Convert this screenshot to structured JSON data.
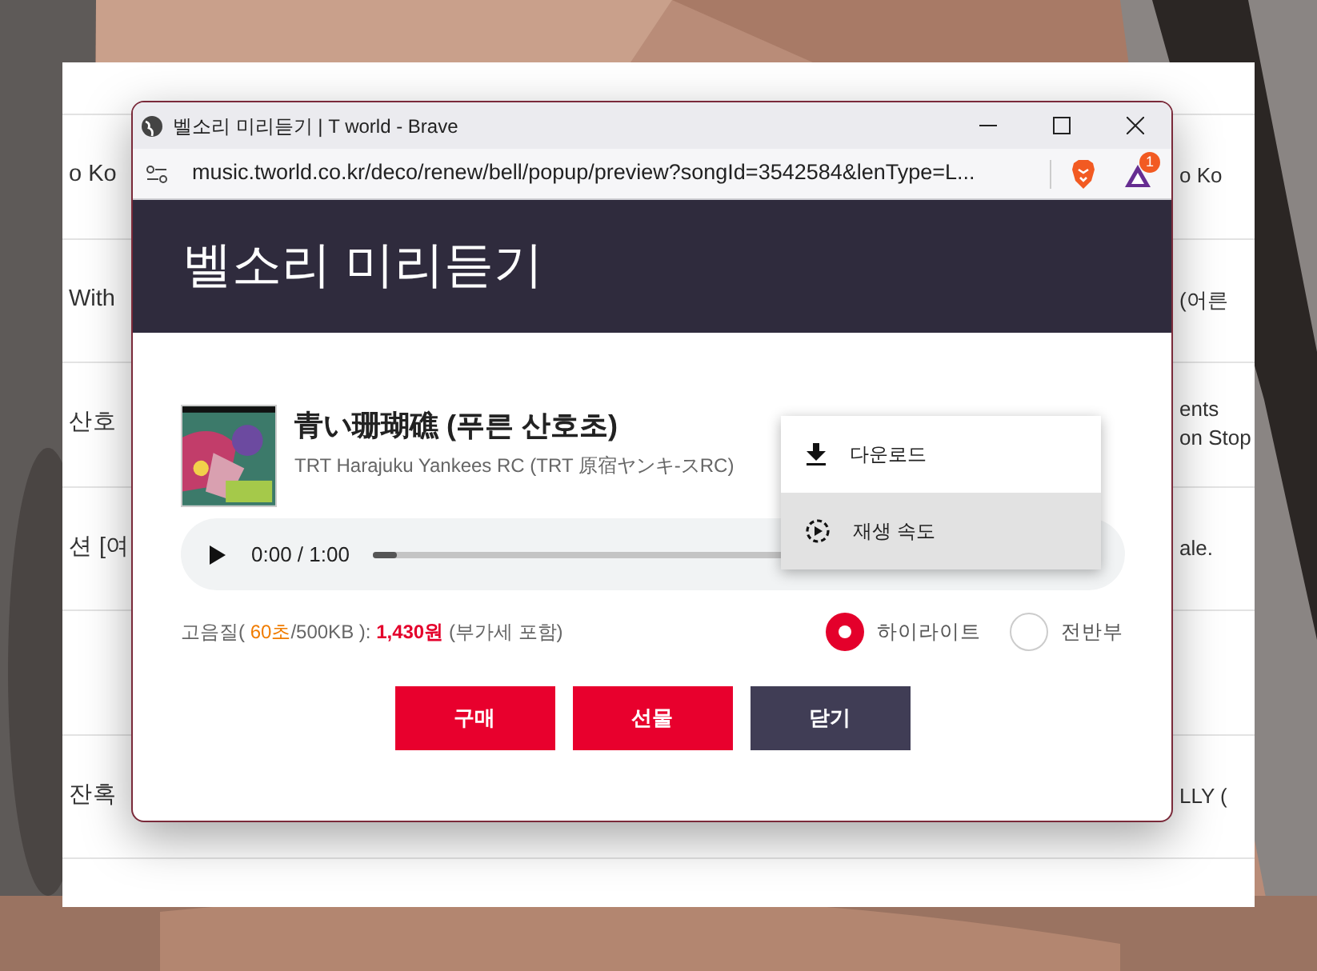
{
  "background_page": {
    "rows": [
      {
        "left": "o Ko",
        "right": [
          "o Ko"
        ]
      },
      {
        "left": "With",
        "right": [
          "(어른"
        ]
      },
      {
        "left": "산호",
        "right": [
          "ents",
          "on Stop"
        ]
      },
      {
        "left": "션 [여",
        "right": [
          "ale."
        ]
      },
      {},
      {
        "left": "잔혹",
        "right": [
          "LLY ("
        ]
      }
    ]
  },
  "window": {
    "title": "벨소리 미리듣기 | T world - Brave",
    "url": "music.tworld.co.kr/deco/renew/bell/popup/preview?songId=3542584&lenType=L...",
    "notification_count": "1"
  },
  "header": {
    "title": "벨소리 미리듣기"
  },
  "song": {
    "title": "青い珊瑚礁 (푸른 산호초)",
    "artist": "TRT Harajuku Yankees RC (TRT 原宿ヤンキ-スRC)"
  },
  "player": {
    "time": "0:00 / 1:00",
    "level": 0.04
  },
  "context_menu": [
    {
      "kind": "download",
      "label": "다운로드",
      "selected": false
    },
    {
      "kind": "speed",
      "label": "재생 속도",
      "selected": true
    }
  ],
  "price_info": {
    "prefix": "고음질( ",
    "duration": "60초",
    "size": "/500KB ): ",
    "price": "1,430원",
    "suffix": " (부가세 포함)"
  },
  "length_options": [
    {
      "label": "하이라이트",
      "selected": true
    },
    {
      "label": "전반부",
      "selected": false
    }
  ],
  "buttons": [
    {
      "label": "구매",
      "kind": "primary"
    },
    {
      "label": "선물",
      "kind": "primary"
    },
    {
      "label": "닫기",
      "kind": "secondary"
    }
  ]
}
